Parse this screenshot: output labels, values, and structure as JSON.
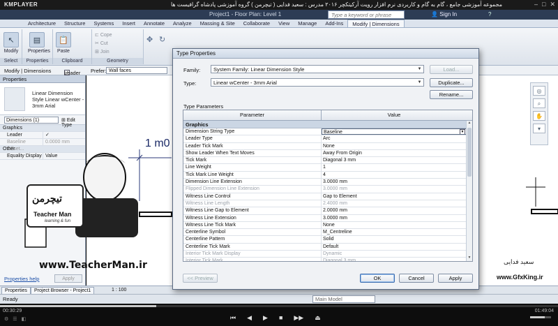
{
  "player": {
    "logo": "KMPLAYER",
    "caption": "مجموعه آموزشی جامع ، گام به گام و کاربردی نرم افزار رویت آرکیتکچر ۲۰۱۶ مدرس : سعید فدایی ( تیچرمن ) گروه آموزشی پادشاه گرافیست ها",
    "time_elapsed": "00:30:29",
    "time_total": "01:49:04",
    "progress": 0.28,
    "volume": 0.7
  },
  "app": {
    "project_title": "Project1 - Floor Plan: Level 1",
    "search_placeholder": "Type a keyword or phrase",
    "sign_in": "Sign In"
  },
  "ribbon": {
    "tabs": [
      "Architecture",
      "Structure",
      "Systems",
      "Insert",
      "Annotate",
      "Analyze",
      "Massing & Site",
      "Collaborate",
      "View",
      "Manage",
      "Add-Ins",
      "Modify | Dimensions"
    ],
    "active_tab": "Modify | Dimensions",
    "groups": {
      "select": "Select",
      "properties": "Properties",
      "clipboard": "Clipboard",
      "geometry": "Geometry"
    },
    "buttons": {
      "modify": "Modify",
      "properties": "Properties",
      "paste": "Paste"
    },
    "geometry_items": [
      "Cope",
      "Cut",
      "Join"
    ]
  },
  "options_bar": {
    "context": "Modify | Dimensions",
    "leader_label": "Leader",
    "prefer_label": "Prefer:",
    "prefer_value": "Wall faces"
  },
  "properties_panel": {
    "header": "Properties",
    "type_name": "Linear Dimension Style Linear wCenter - 3mm Arial",
    "filter": "Dimensions (1)",
    "edit_type": "Edit Type",
    "rows": [
      {
        "cat": "Graphics"
      },
      {
        "k": "Leader",
        "v": "✓"
      },
      {
        "k": "Baseline Offset...",
        "v": "0.0000 mm",
        "dim": true
      },
      {
        "cat": "Other"
      },
      {
        "k": "Equality Display",
        "v": "Value"
      }
    ],
    "help_link": "Properties help",
    "apply": "Apply"
  },
  "bottom_tabs": {
    "properties": "Properties",
    "project_browser": "Project Browser - Project1",
    "scale": "1 : 100"
  },
  "status": {
    "ready": "Ready",
    "model": "Main Model"
  },
  "canvas": {
    "dim_text": "1 m0"
  },
  "watermark": {
    "url": "www.TeacherMan.ir",
    "gfx": "www.GfxKing.ir",
    "signature": "سعید فدایی",
    "logo_text": "تیچرمن",
    "logo_sub": "Teacher Man",
    "logo_tag": "learning & fun"
  },
  "dialog": {
    "title": "Type Properties",
    "family_label": "Family:",
    "family_value": "System Family: Linear Dimension Style",
    "type_label": "Type:",
    "type_value": "Linear wCenter - 3mm Arial",
    "load": "Load...",
    "duplicate": "Duplicate...",
    "rename": "Rename...",
    "type_params": "Type Parameters",
    "col_param": "Parameter",
    "col_value": "Value",
    "category": "Graphics",
    "rows": [
      {
        "p": "Dimension String Type",
        "v": "Baseline",
        "sel": true
      },
      {
        "p": "Leader Type",
        "v": "Arc"
      },
      {
        "p": "Leader Tick Mark",
        "v": "None"
      },
      {
        "p": "Show Leader When Text Moves",
        "v": "Away From Origin"
      },
      {
        "p": "Tick Mark",
        "v": "Diagonal 3 mm"
      },
      {
        "p": "Line Weight",
        "v": "1"
      },
      {
        "p": "Tick Mark Line Weight",
        "v": "4"
      },
      {
        "p": "Dimension Line Extension",
        "v": "3.0000 mm"
      },
      {
        "p": "Flipped Dimension Line Extension",
        "v": "3.0000 mm",
        "dim": true
      },
      {
        "p": "Witness Line Control",
        "v": "Gap to Element"
      },
      {
        "p": "Witness Line Length",
        "v": "2.4000 mm",
        "dim": true
      },
      {
        "p": "Witness Line Gap to Element",
        "v": "2.0000 mm"
      },
      {
        "p": "Witness Line Extension",
        "v": "3.0000 mm"
      },
      {
        "p": "Witness Line Tick Mark",
        "v": "None"
      },
      {
        "p": "Centerline Symbol",
        "v": "M_Centreline"
      },
      {
        "p": "Centerline Pattern",
        "v": "Solid"
      },
      {
        "p": "Centerline Tick Mark",
        "v": "Default"
      },
      {
        "p": "Interior Tick Mark Display",
        "v": "Dynamic",
        "dim": true
      },
      {
        "p": "Interior Tick Mark",
        "v": "Diagonal 3 mm",
        "dim": true
      }
    ],
    "preview": "<< Preview",
    "ok": "OK",
    "cancel": "Cancel",
    "apply": "Apply"
  }
}
